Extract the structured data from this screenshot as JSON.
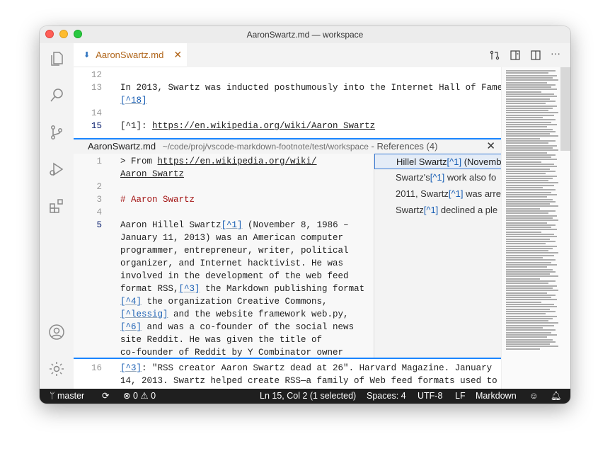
{
  "window": {
    "title": "AaronSwartz.md — workspace"
  },
  "tab": {
    "label": "AaronSwartz.md"
  },
  "editor_lines": [
    {
      "num": "12",
      "parts": []
    },
    {
      "num": "13",
      "parts": [
        {
          "t": "In 2013, Swartz was inducted posthumously into the Internet Hall of Fame."
        }
      ]
    },
    {
      "num": "",
      "parts": [
        {
          "t": "[^18]",
          "c": "link-ref"
        }
      ]
    },
    {
      "num": "14",
      "parts": []
    },
    {
      "num": "15",
      "active": true,
      "parts": [
        {
          "t": "[^1]: "
        },
        {
          "t": "https://en.wikipedia.org/wiki/Aaron_Swartz",
          "c": "url"
        }
      ]
    }
  ],
  "peek": {
    "file": "AaronSwartz.md",
    "path": "~/code/proj/vscode-markdown-footnote/test/workspace",
    "title": " - References (4)",
    "lines": [
      {
        "num": "1",
        "parts": [
          {
            "t": "> From "
          },
          {
            "t": "https://en.wikipedia.org/wiki/",
            "c": "url"
          }
        ]
      },
      {
        "num": "",
        "parts": [
          {
            "t": "Aaron_Swartz",
            "c": "url"
          }
        ]
      },
      {
        "num": "2",
        "parts": []
      },
      {
        "num": "3",
        "parts": [
          {
            "t": "# Aaron Swartz",
            "c": "heading"
          }
        ]
      },
      {
        "num": "4",
        "parts": []
      },
      {
        "num": "5",
        "active": true,
        "parts": [
          {
            "t": "Aaron Hillel Swartz"
          },
          {
            "t": "[^1]",
            "c": "link-ref"
          },
          {
            "t": " (November 8, 1986 –"
          }
        ]
      },
      {
        "num": "",
        "parts": [
          {
            "t": "January 11, 2013) was an American computer"
          }
        ]
      },
      {
        "num": "",
        "parts": [
          {
            "t": "programmer, entrepreneur, writer, political"
          }
        ]
      },
      {
        "num": "",
        "parts": [
          {
            "t": "organizer, and Internet hacktivist. He was"
          }
        ]
      },
      {
        "num": "",
        "parts": [
          {
            "t": "involved in the development of the web feed"
          }
        ]
      },
      {
        "num": "",
        "parts": [
          {
            "t": "format RSS,"
          },
          {
            "t": "[^3]",
            "c": "link-ref"
          },
          {
            "t": " the Markdown publishing format,"
          }
        ]
      },
      {
        "num": "",
        "parts": [
          {
            "t": "[^4]",
            "c": "link-ref"
          },
          {
            "t": " the organization Creative Commons,"
          }
        ]
      },
      {
        "num": "",
        "parts": [
          {
            "t": "[^lessig]",
            "c": "link-ref"
          },
          {
            "t": " and the website framework web.py,"
          }
        ]
      },
      {
        "num": "",
        "parts": [
          {
            "t": "[^6]",
            "c": "link-ref"
          },
          {
            "t": " and was a co-founder of the social news"
          }
        ]
      },
      {
        "num": "",
        "parts": [
          {
            "t": "site Reddit. He was given the title of"
          }
        ]
      },
      {
        "num": "",
        "parts": [
          {
            "t": "co-founder of Reddit by Y Combinator owner"
          }
        ]
      }
    ],
    "refs": [
      {
        "pre": "Hillel Swartz",
        "hl": "[^1]",
        "post": " (November",
        "selected": true
      },
      {
        "pre": "Swartz's",
        "hl": "[^1]",
        "post": " work also fo"
      },
      {
        "pre": "2011, Swartz",
        "hl": "[^1]",
        "post": " was arre"
      },
      {
        "pre": "Swartz",
        "hl": "[^1]",
        "post": " declined a ple"
      }
    ]
  },
  "bottom_lines": [
    {
      "num": "16",
      "parts": [
        {
          "t": "[^3]",
          "c": "link-ref"
        },
        {
          "t": ": \"RSS creator Aaron Swartz dead at 26\". Harvard Magazine. January"
        }
      ]
    },
    {
      "num": "",
      "parts": [
        {
          "t": "14, 2013. Swartz helped create RSS—a family of Web feed formats used to"
        }
      ]
    }
  ],
  "status": {
    "branch": "master",
    "problems": "0",
    "warnings": "0",
    "position": "Ln 15, Col 2 (1 selected)",
    "spaces": "Spaces: 4",
    "encoding": "UTF-8",
    "eol": "LF",
    "language": "Markdown"
  },
  "icons": [
    "files-icon",
    "search-icon",
    "source-control-icon",
    "run-debug-icon",
    "extensions-icon",
    "account-icon",
    "settings-gear-icon"
  ],
  "colors": {
    "accent": "#1a85ff",
    "tab_text": "#b0651a",
    "statusbar": "#1f1f1f"
  }
}
